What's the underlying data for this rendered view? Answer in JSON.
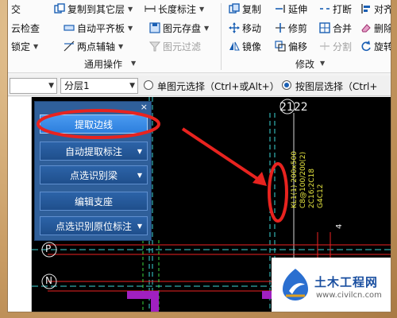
{
  "ribbon": {
    "row1": [
      {
        "id": "cut-left",
        "label": "交",
        "dimmed": false
      },
      {
        "id": "copy-floor",
        "label": "复制到其它层",
        "dimmed": false
      },
      {
        "id": "length-dim",
        "label": "长度标注",
        "dimmed": false
      },
      {
        "id": "copy",
        "label": "复制",
        "dimmed": false
      },
      {
        "id": "extend",
        "label": "延伸",
        "dimmed": false
      },
      {
        "id": "break",
        "label": "打断",
        "dimmed": false
      },
      {
        "id": "align",
        "label": "对齐",
        "dimmed": false
      }
    ],
    "row2": [
      {
        "id": "cloud-check",
        "label": "云检查"
      },
      {
        "id": "auto-flush",
        "label": "自动平齐板"
      },
      {
        "id": "save-elem",
        "label": "图元存盘"
      },
      {
        "id": "move",
        "label": "移动"
      },
      {
        "id": "trim",
        "label": "修剪"
      },
      {
        "id": "merge",
        "label": "合并"
      },
      {
        "id": "delete",
        "label": "删除"
      }
    ],
    "row3": [
      {
        "id": "lock",
        "label": "锁定"
      },
      {
        "id": "two-axis",
        "label": "两点辅轴"
      },
      {
        "id": "filter-elem",
        "label": "图元过滤"
      },
      {
        "id": "mirror",
        "label": "镜像"
      },
      {
        "id": "offset",
        "label": "偏移"
      },
      {
        "id": "split",
        "label": "分割"
      },
      {
        "id": "rotate",
        "label": "旋转"
      }
    ],
    "groups": {
      "common": "通用操作",
      "modify": "修改"
    }
  },
  "filterbar": {
    "combo1": "",
    "layer": "分层1",
    "radio1": "单图元选择（Ctrl+或Alt+）",
    "radio2": "按图层选择（Ctrl+"
  },
  "panel": {
    "close": "×",
    "buttons": [
      {
        "label": "提取边线",
        "dropdown": false
      },
      {
        "label": "自动提取标注",
        "dropdown": true
      },
      {
        "label": "点选识别梁",
        "dropdown": true
      },
      {
        "label": "编辑支座",
        "dropdown": false
      },
      {
        "label": "点选识别原位标注",
        "dropdown": true
      }
    ]
  },
  "canvas": {
    "grid_label_top": "2122",
    "axis_label_p": "P",
    "axis_label_n": "N",
    "beam_text_1": "KL1(1) 200x500",
    "beam_text_2": "C8@100/200(2)",
    "beam_text_3": "2C16;2C18",
    "beam_text_4": "G4C12",
    "side_mark": "4"
  },
  "watermark": {
    "title": "土木工程网",
    "url": "www.civilcn.com"
  },
  "colors": {
    "panel_bg": "#2f5f9a",
    "active_button": "#3d8fe8",
    "annotation": "#e8231f",
    "canvas": "#000000"
  }
}
